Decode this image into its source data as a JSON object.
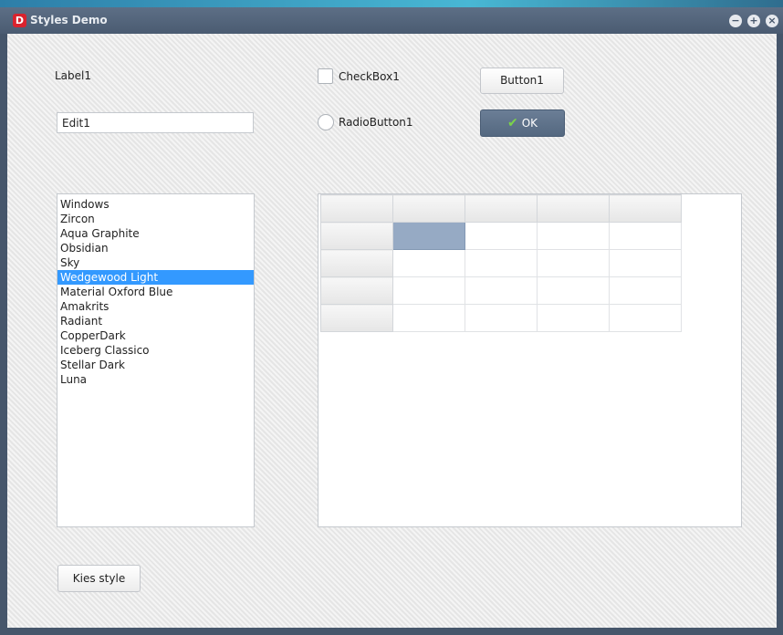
{
  "window": {
    "title": "Styles Demo",
    "icon_letter": "D"
  },
  "titlebar_buttons": {
    "minimize": "−",
    "maximize": "+",
    "close": "×"
  },
  "controls": {
    "label1": "Label1",
    "edit1_value": "Edit1",
    "checkbox1_label": "CheckBox1",
    "checkbox1_checked": false,
    "radiobutton1_label": "RadioButton1",
    "radiobutton1_checked": false,
    "button1_label": "Button1",
    "ok_label": "OK",
    "kies_style_label": "Kies style"
  },
  "style_list": {
    "items": [
      "Windows",
      "Zircon",
      "Aqua Graphite",
      "Obsidian",
      "Sky",
      "Wedgewood Light",
      "Material Oxford Blue",
      "Amakrits",
      "Radiant",
      "CopperDark",
      "Iceberg Classico",
      "Stellar Dark",
      "Luna"
    ],
    "selected": "Wedgewood Light"
  },
  "grid": {
    "columns": 5,
    "rows": 5,
    "fixed_rows": 1,
    "fixed_cols": 1,
    "selected_cell": [
      1,
      1
    ]
  },
  "colors": {
    "selection": "#3399ff",
    "grid_selection": "#96aac4",
    "ok_button": "#5e7189",
    "titlebar": "#4a5b71",
    "app_icon": "#d9232e"
  }
}
